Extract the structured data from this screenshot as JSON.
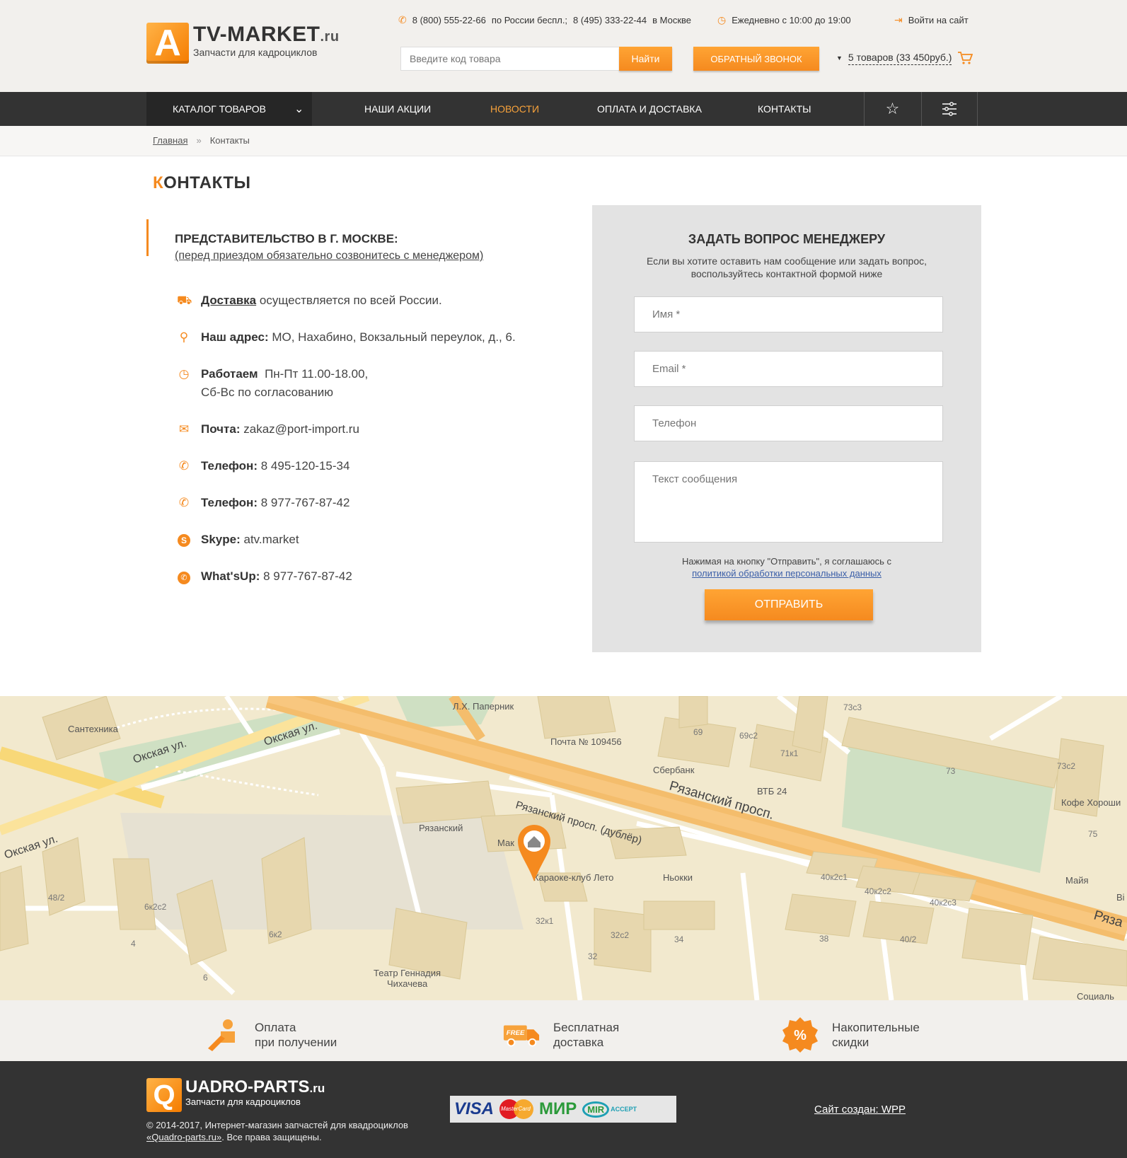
{
  "header": {
    "logo_letter": "A",
    "logo_title": "TV-MARKET",
    "logo_domain": ".ru",
    "logo_sub": "Запчасти для кадроциклов",
    "phone1": "8 (800) 555-22-66",
    "phone1_note": "по России беспл.;",
    "phone2": "8 (495) 333-22-44",
    "phone2_note": "в Москве",
    "hours": "Ежедневно с 10:00 до 19:00",
    "login": "Войти на сайт",
    "search_placeholder": "Введите код товара",
    "search_button": "Найти",
    "callback": "ОБРАТНЫЙ ЗВОНОК",
    "cart": "5 товаров (33 450руб.)"
  },
  "nav": {
    "catalog": "КАТАЛОГ ТОВАРОВ",
    "items": [
      {
        "label": "НАШИ АКЦИИ",
        "active": false
      },
      {
        "label": "НОВОСТИ",
        "active": true
      },
      {
        "label": "ОПЛАТА И ДОСТАВКА",
        "active": false
      },
      {
        "label": "КОНТАКТЫ",
        "active": false
      }
    ]
  },
  "breadcrumbs": {
    "home": "Главная",
    "sep": "»",
    "current": "Контакты"
  },
  "page": {
    "title_first": "К",
    "title_rest": "ОНТАКТЫ"
  },
  "office": {
    "title": "ПРЕДСТАВИТЕЛЬСТВО В Г. МОСКВЕ:",
    "note": "(перед приездом обязательно созвонитесь с менеджером)"
  },
  "contacts": {
    "delivery_label": "Доставка",
    "delivery_text": "осуществляется по всей России.",
    "address_label": "Наш адрес:",
    "address_text": "МО, Нахабино, Вокзальный переулок, д., 6.",
    "work_label": "Работаем",
    "work_text1": "Пн-Пт 11.00-18.00,",
    "work_text2": "Сб-Вс по согласованию",
    "mail_label": "Почта:",
    "mail_text": "zakaz@port-import.ru",
    "phone_label": "Телефон:",
    "phone1": "8 495-120-15-34",
    "phone2": "8 977-767-87-42",
    "skype_label": "Skype:",
    "skype_text": "atv.market",
    "whatsapp_label": "What'sUp:",
    "whatsapp_text": "8 977-767-87-42"
  },
  "form": {
    "title": "ЗАДАТЬ ВОПРОС МЕНЕДЖЕРУ",
    "desc": "Если вы хотите оставить нам сообщение или задать вопрос, воспользуйтесь контактной формой ниже",
    "name_placeholder": "Имя *",
    "email_placeholder": "Email *",
    "phone_placeholder": "Телефон",
    "message_placeholder": "Текст сообщения",
    "consent": "Нажимая на кнопку \"Отправить\", я соглашаюсь с",
    "consent_link": "политикой обработки персональных данных",
    "submit": "ОТПРАВИТЬ"
  },
  "map": {
    "streets": [
      "Окская ул.",
      "Окская ул.",
      "Окская ул.",
      "Рязанский просп.",
      "Рязанский просп. (дублёр)",
      "Ряза"
    ],
    "places": [
      "Сантехника",
      "Л.Х. Паперник",
      "Почта № 109456",
      "Сбербанк",
      "ВТБ 24",
      "Рязанский",
      "Караоке-клуб Лето",
      "Ньокки",
      "Театр Геннадия",
      "Чихачева",
      "Кофе Хороши",
      "Майя",
      "Мак",
      "Bi",
      "Социаль"
    ],
    "buildings": [
      "69",
      "69с2",
      "71к1",
      "73с3",
      "73",
      "73с2",
      "75",
      "40к2с1",
      "40к2с2",
      "40к2с3",
      "48/2",
      "6к2с2",
      "4",
      "6к2",
      "6",
      "32к1",
      "32с2",
      "32",
      "34",
      "38",
      "40/2"
    ]
  },
  "features": [
    {
      "line1": "Оплата",
      "line2": "при получении"
    },
    {
      "line1": "Бесплатная",
      "line2": "доставка"
    },
    {
      "line1": "Накопительные",
      "line2": "скидки"
    }
  ],
  "footer": {
    "logo_letter": "Q",
    "logo_title": "UADRO-PARTS",
    "logo_domain": ".ru",
    "logo_sub": "Запчасти для кадроциклов",
    "copy1": "© 2014-2017, Интернет-магазин запчастей для квадроциклов",
    "copy2_link": "«Quadro-parts.ru»",
    "copy2_rest": ". Все права защищены.",
    "made": "Сайт создан:  WPP"
  },
  "payment": {
    "visa": "VISA",
    "mastercard": "MasterCard",
    "mir": "МИР",
    "mir_accept_prefix": "MIR",
    "mir_accept": "ACCEPT"
  },
  "free_label": "FREE",
  "colors": {
    "accent": "#f58a1f",
    "nav_bg": "#333333",
    "link": "#3b5fa8"
  }
}
